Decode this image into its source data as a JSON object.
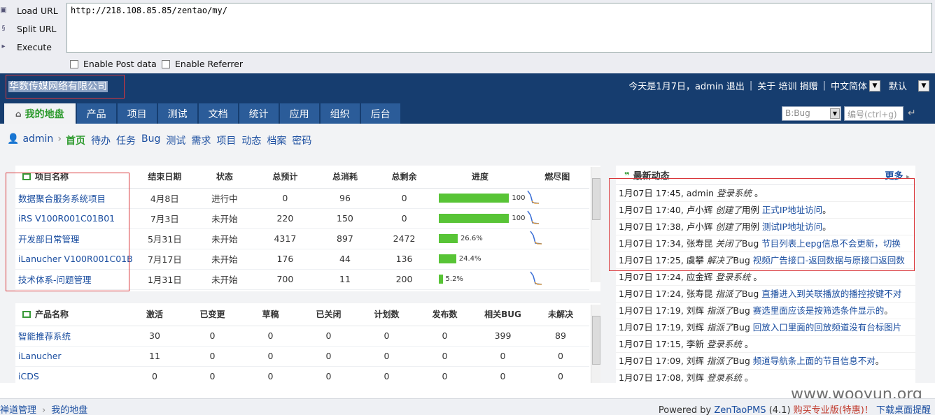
{
  "hackbar": {
    "load_url": "Load URL",
    "split_url": "Split URL",
    "execute": "Execute",
    "url": "http://218.108.85.85/zentao/my/",
    "enable_post": "Enable Post data",
    "enable_referrer": "Enable Referrer"
  },
  "header": {
    "company": "华数传媒网络有限公司",
    "today": "今天是1月7日，admin",
    "logout": "退出",
    "about": "关于",
    "training": "培训",
    "donate": "捐赠",
    "language": "中文简体",
    "theme": "默认",
    "nav": [
      "我的地盘",
      "产品",
      "项目",
      "测试",
      "文档",
      "统计",
      "应用",
      "组织",
      "后台"
    ],
    "search_type": "B:Bug",
    "search_placeholder": "编号(ctrl+g)"
  },
  "subnav": {
    "user": "admin",
    "items": [
      "首页",
      "待办",
      "任务",
      "Bug",
      "测试",
      "需求",
      "项目",
      "动态",
      "档案",
      "密码"
    ]
  },
  "projects": {
    "headers": [
      "项目名称",
      "结束日期",
      "状态",
      "总预计",
      "总消耗",
      "总剩余",
      "进度",
      "燃尽图"
    ],
    "rows": [
      {
        "name": "数据聚合服务系统项目",
        "end": "4月8日",
        "status": "进行中",
        "estimate": "0",
        "consumed": "96",
        "left": "0",
        "progress": 100,
        "progress_label": "100"
      },
      {
        "name": "iRS V100R001C01B01",
        "end": "7月3日",
        "status": "未开始",
        "estimate": "220",
        "consumed": "150",
        "left": "0",
        "progress": 100,
        "progress_label": "100"
      },
      {
        "name": "开发部日常管理",
        "end": "5月31日",
        "status": "未开始",
        "estimate": "4317",
        "consumed": "897",
        "left": "2472",
        "progress": 26.6,
        "progress_label": "26.6%"
      },
      {
        "name": "iLanucher V100R001C01B",
        "end": "7月17日",
        "status": "未开始",
        "estimate": "176",
        "consumed": "44",
        "left": "136",
        "progress": 24.4,
        "progress_label": "24.4%"
      },
      {
        "name": "技术体系-问题管理",
        "end": "1月31日",
        "status": "未开始",
        "estimate": "700",
        "consumed": "11",
        "left": "200",
        "progress": 5.2,
        "progress_label": "5.2%"
      }
    ]
  },
  "products": {
    "headers": [
      "产品名称",
      "激活",
      "已变更",
      "草稿",
      "已关闭",
      "计划数",
      "发布数",
      "相关BUG",
      "未解决"
    ],
    "rows": [
      {
        "name": "智能推荐系统",
        "vals": [
          "30",
          "0",
          "0",
          "0",
          "0",
          "0",
          "399",
          "89"
        ]
      },
      {
        "name": "iLanucher",
        "vals": [
          "11",
          "0",
          "0",
          "0",
          "0",
          "0",
          "0",
          "0"
        ]
      },
      {
        "name": "iCDS",
        "vals": [
          "0",
          "0",
          "0",
          "0",
          "0",
          "0",
          "0",
          "0"
        ]
      }
    ]
  },
  "dynamics": {
    "title": "最新动态",
    "more": "更多",
    "items": [
      {
        "time": "1月07日 17:45,",
        "user": "admin",
        "action": "登录系统",
        "type": "",
        "object": "",
        "tail": "。"
      },
      {
        "time": "1月07日 17:40,",
        "user": "卢小辉",
        "action": "创建了",
        "type": "用例",
        "object": "正式IP地址访问",
        "tail": "。"
      },
      {
        "time": "1月07日 17:38,",
        "user": "卢小辉",
        "action": "创建了",
        "type": "用例",
        "object": "测试IP地址访问",
        "tail": "。"
      },
      {
        "time": "1月07日 17:34,",
        "user": "张寿昆",
        "action": "关闭了",
        "type": "Bug",
        "object": "节目列表上epg信息不会更新，切换",
        "tail": ""
      },
      {
        "time": "1月07日 17:25,",
        "user": "虞攀",
        "action": "解决了",
        "type": "Bug",
        "object": "视频广告接口-返回数据与原接口返回数",
        "tail": ""
      },
      {
        "time": "1月07日 17:24,",
        "user": "应金辉",
        "action": "登录系统",
        "type": "",
        "object": "",
        "tail": "。"
      },
      {
        "time": "1月07日 17:24,",
        "user": "张寿昆",
        "action": "指派了",
        "type": "Bug",
        "object": "直播进入到关联播放的播控按键不对",
        "tail": ""
      },
      {
        "time": "1月07日 17:19,",
        "user": "刘辉",
        "action": "指派了",
        "type": "Bug",
        "object": "赛选里面应该是按筛选条件显示的",
        "tail": "。"
      },
      {
        "time": "1月07日 17:19,",
        "user": "刘辉",
        "action": "指派了",
        "type": "Bug",
        "object": "回放入口里面的回放频道没有台标图片",
        "tail": ""
      },
      {
        "time": "1月07日 17:15,",
        "user": "李新",
        "action": "登录系统",
        "type": "",
        "object": "",
        "tail": "。"
      },
      {
        "time": "1月07日 17:09,",
        "user": "刘辉",
        "action": "指派了",
        "type": "Bug",
        "object": "频道导航条上面的节目信息不对",
        "tail": "。"
      },
      {
        "time": "1月07日 17:08,",
        "user": "刘辉",
        "action": "登录系统",
        "type": "",
        "object": "",
        "tail": "。"
      }
    ]
  },
  "footer": {
    "crumb1": "禅道管理",
    "crumb2": "我的地盘",
    "powered": "Powered by",
    "zentao": "ZenTaoPMS",
    "version": "(4.1)",
    "buy": "购买专业版(特惠)",
    "bang": "！",
    "download": "下载桌面提醒"
  },
  "watermark": "www.wooyun.org",
  "colors": {
    "header_bg": "#163d6f",
    "nav_tab": "#2b5c99",
    "progress": "#58c436",
    "active_green": "#2e9b2e",
    "link_blue": "#1b4ea0",
    "highlight_red": "#d9363a"
  }
}
